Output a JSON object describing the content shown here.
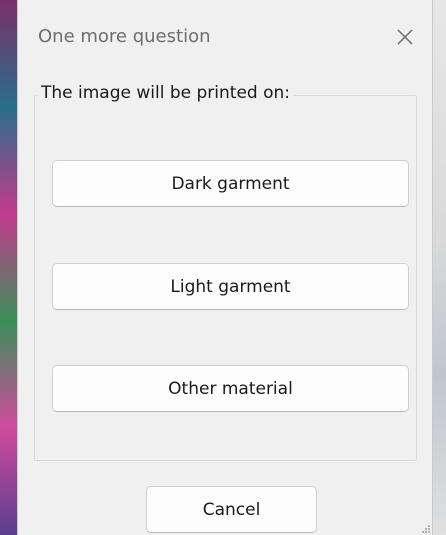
{
  "dialog": {
    "title": "One more question",
    "close_icon": "close-icon"
  },
  "group": {
    "label": "The image will be printed on:",
    "options": [
      {
        "label": "Dark garment"
      },
      {
        "label": "Light garment"
      },
      {
        "label": "Other material"
      }
    ]
  },
  "footer": {
    "cancel_label": "Cancel"
  },
  "colors": {
    "dialog_background": "#f0f0f0",
    "button_background": "#fdfdfd",
    "title_text": "#6d6d6d"
  }
}
